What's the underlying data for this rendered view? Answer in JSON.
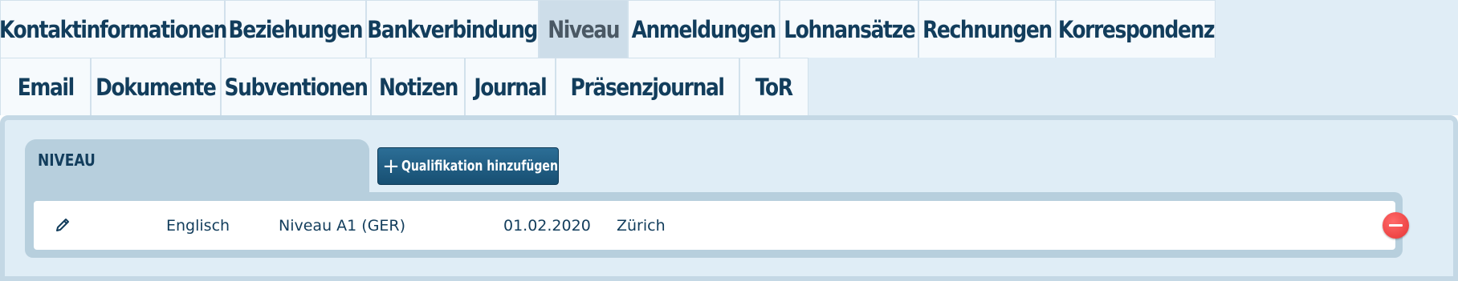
{
  "tabs_row1": [
    {
      "label": "Kontaktinformationen",
      "active": false
    },
    {
      "label": "Beziehungen",
      "active": false
    },
    {
      "label": "Bankverbindung",
      "active": false
    },
    {
      "label": "Niveau",
      "active": true
    },
    {
      "label": "Anmeldungen",
      "active": false
    },
    {
      "label": "Lohnansätze",
      "active": false
    },
    {
      "label": "Rechnungen",
      "active": false
    },
    {
      "label": "Korrespondenz",
      "active": false
    }
  ],
  "tabs_row2": [
    {
      "label": "Email",
      "active": false
    },
    {
      "label": "Dokumente",
      "active": false
    },
    {
      "label": "Subventionen",
      "active": false
    },
    {
      "label": "Notizen",
      "active": false
    },
    {
      "label": "Journal",
      "active": false
    },
    {
      "label": "Präsenzjournal",
      "active": false
    },
    {
      "label": "ToR",
      "active": false
    }
  ],
  "section": {
    "title": "NIVEAU",
    "add_button_label": "Qualifikation hinzufügen",
    "add_button_icon": "plus-icon"
  },
  "qualifications": [
    {
      "language": "Englisch",
      "level": "Niveau A1 (GER)",
      "date": "01.02.2020",
      "location": "Zürich",
      "edit_icon": "pencil-icon",
      "remove_icon": "minus-circle-icon"
    }
  ],
  "colors": {
    "tab_text": "#123d5c",
    "active_tab_bg": "#cddde9",
    "panel_bg": "#dfedf6",
    "button_bg": "#1f5b82",
    "remove_red": "#e63434"
  }
}
